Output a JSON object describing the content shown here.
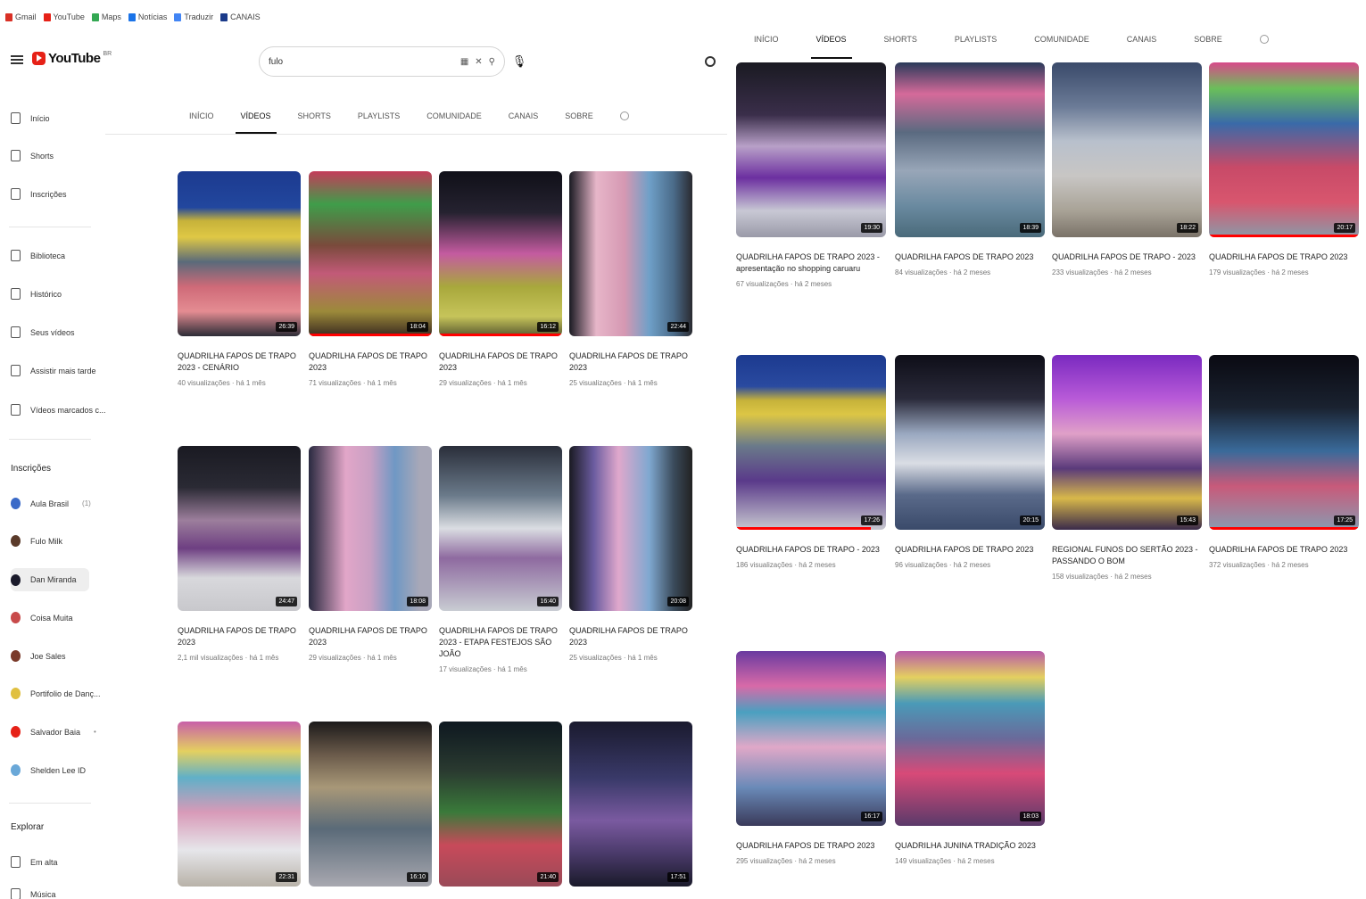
{
  "bookmarks": [
    {
      "label": "Gmail",
      "color": "#d93025"
    },
    {
      "label": "YouTube",
      "color": "#e62117"
    },
    {
      "label": "Maps",
      "color": "#34a853"
    },
    {
      "label": "Notícias",
      "color": "#1a73e8"
    },
    {
      "label": "Traduzir",
      "color": "#4285f4"
    },
    {
      "label": "CANAIS",
      "color": "#1a3a8a"
    }
  ],
  "header": {
    "logo_text": "YouTube",
    "logo_country": "BR",
    "search_value": "fulo",
    "brand_color": "#e62117"
  },
  "sidebar": {
    "items": [
      {
        "label": "Início",
        "icon": "home-icon"
      },
      {
        "label": "Shorts",
        "icon": "shorts-icon"
      },
      {
        "label": "Inscrições",
        "icon": "subscriptions-icon"
      },
      {
        "label": "Biblioteca",
        "icon": "library-icon"
      },
      {
        "label": "Histórico",
        "icon": "history-icon"
      },
      {
        "label": "Seus vídeos",
        "icon": "your-videos-icon"
      },
      {
        "label": "Assistir mais tarde",
        "icon": "watch-later-icon"
      },
      {
        "label": "Vídeos marcados c...",
        "icon": "liked-icon"
      }
    ],
    "subscriptions_title": "Inscrições",
    "subscriptions": [
      {
        "label": "Aula Brasil",
        "badge": "(1)",
        "color": "#3a6ac8"
      },
      {
        "label": "Fulo Milk",
        "color": "#5a3a2a"
      },
      {
        "label": "Dan Miranda",
        "color": "#1a1a2a",
        "active": true
      },
      {
        "label": "Coisa Muita",
        "color": "#c84a4a"
      },
      {
        "label": "Joe Sales",
        "color": "#7a3a2a"
      },
      {
        "label": "Portifolio de Danç...",
        "color": "#e0c040"
      },
      {
        "label": "Salvador Baia",
        "badge": "•",
        "color": "#e62117"
      },
      {
        "label": "Shelden Lee ID",
        "color": "#6aa8d8"
      }
    ],
    "explore_title": "Explorar",
    "explore": [
      {
        "label": "Em alta",
        "icon": "trending-icon"
      },
      {
        "label": "Música",
        "icon": "music-icon"
      }
    ]
  },
  "tabs": [
    "INÍCIO",
    "VÍDEOS",
    "SHORTS",
    "PLAYLISTS",
    "COMUNIDADE",
    "CANAIS",
    "SOBRE"
  ],
  "active_tab": 1,
  "left_videos": [
    {
      "title": "QUADRILHA FAPOS DE TRAPO 2023 - CENÁRIO",
      "meta": "40 visualizações · há 1 mês",
      "duration": "26:39",
      "cls": "t1",
      "progress": 0
    },
    {
      "title": "QUADRILHA FAPOS DE TRAPO 2023",
      "meta": "71 visualizações · há 1 mês",
      "duration": "18:04",
      "cls": "t2",
      "progress": 1.0
    },
    {
      "title": "QUADRILHA FAPOS DE TRAPO 2023",
      "meta": "29 visualizações · há 1 mês",
      "duration": "16:12",
      "cls": "t3",
      "progress": 1.0
    },
    {
      "title": "QUADRILHA FAPOS DE TRAPO 2023",
      "meta": "25 visualizações · há 1 mês",
      "duration": "22:44",
      "cls": "t4",
      "progress": 0
    },
    {
      "title": "QUADRILHA FAPOS DE TRAPO 2023",
      "meta": "2,1 mil visualizações · há 1 mês",
      "duration": "24:47",
      "cls": "t5",
      "progress": 0
    },
    {
      "title": "QUADRILHA FAPOS DE TRAPO 2023",
      "meta": "29 visualizações · há 1 mês",
      "duration": "18:08",
      "cls": "t6",
      "progress": 0
    },
    {
      "title": "QUADRILHA FAPOS DE TRAPO 2023 - ETAPA FESTEJOS SÃO JOÃO",
      "meta": "17 visualizações · há 1 mês",
      "duration": "16:40",
      "cls": "t7",
      "progress": 0
    },
    {
      "title": "QUADRILHA FAPOS DE TRAPO 2023",
      "meta": "25 visualizações · há 1 mês",
      "duration": "20:08",
      "cls": "t8",
      "progress": 0
    },
    {
      "title": "",
      "meta": "",
      "duration": "22:31",
      "cls": "t9",
      "progress": 0
    },
    {
      "title": "",
      "meta": "",
      "duration": "16:10",
      "cls": "t10",
      "progress": 0
    },
    {
      "title": "",
      "meta": "",
      "duration": "21:40",
      "cls": "t11",
      "progress": 0
    },
    {
      "title": "",
      "meta": "",
      "duration": "17:51",
      "cls": "t12",
      "progress": 0
    }
  ],
  "right_videos": [
    {
      "title": "QUADRILHA FAPOS DE TRAPO 2023 - apresentação no shopping caruaru",
      "meta": "67 visualizações · há 2 meses",
      "duration": "19:30",
      "cls": "r1",
      "progress": 0
    },
    {
      "title": "QUADRILHA FAPOS DE TRAPO 2023",
      "meta": "84 visualizações · há 2 meses",
      "duration": "18:39",
      "cls": "r2",
      "progress": 0
    },
    {
      "title": "QUADRILHA FAPOS DE TRAPO - 2023",
      "meta": "233 visualizações · há 2 meses",
      "duration": "18:22",
      "cls": "r3",
      "progress": 0
    },
    {
      "title": "QUADRILHA FAPOS DE TRAPO 2023",
      "meta": "179 visualizações · há 2 meses",
      "duration": "20:17",
      "cls": "r4",
      "progress": 1.0
    },
    {
      "title": "QUADRILHA FAPOS DE TRAPO - 2023",
      "meta": "186 visualizações · há 2 meses",
      "duration": "17:26",
      "cls": "r5",
      "progress": 0.9
    },
    {
      "title": "QUADRILHA FAPOS DE TRAPO 2023",
      "meta": "96 visualizações · há 2 meses",
      "duration": "20:15",
      "cls": "r6",
      "progress": 0
    },
    {
      "title": "REGIONAL FUNOS DO SERTÃO 2023 - PASSANDO O BOM",
      "meta": "158 visualizações · há 2 meses",
      "duration": "15:43",
      "cls": "r7",
      "progress": 0
    },
    {
      "title": "QUADRILHA FAPOS DE TRAPO 2023",
      "meta": "372 visualizações · há 2 meses",
      "duration": "17:25",
      "cls": "r8",
      "progress": 1.0
    },
    {
      "title": "QUADRILHA FAPOS DE TRAPO 2023",
      "meta": "295 visualizações · há 2 meses",
      "duration": "16:17",
      "cls": "r9",
      "progress": 0
    },
    {
      "title": "QUADRILHA JUNINA TRADIÇÃO 2023",
      "meta": "149 visualizações · há 2 meses",
      "duration": "18:03",
      "cls": "r10",
      "progress": 0
    }
  ]
}
